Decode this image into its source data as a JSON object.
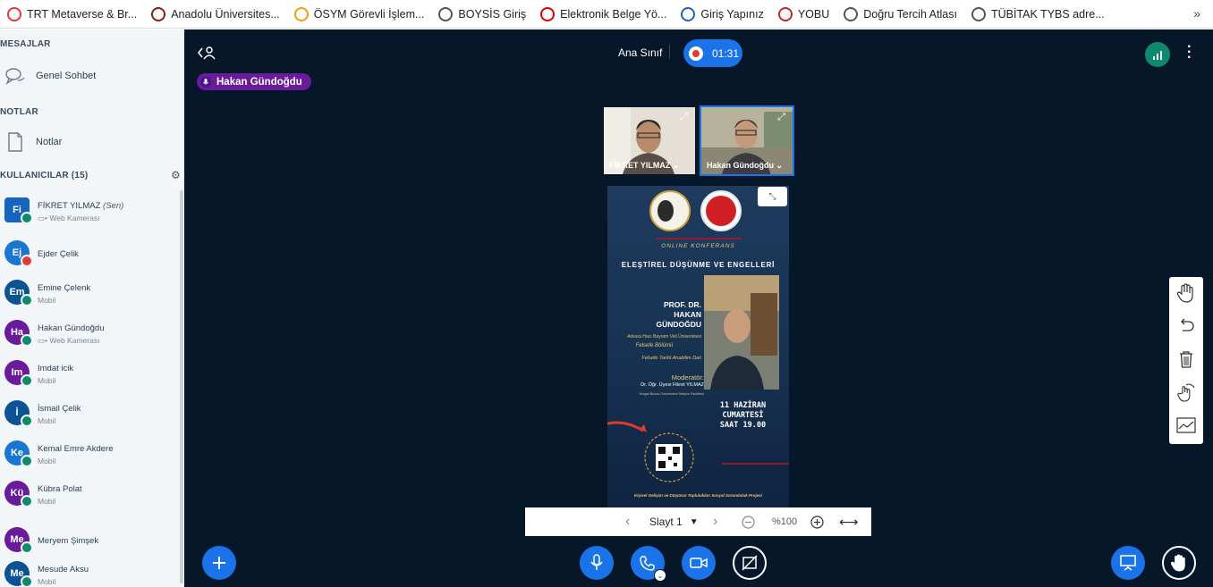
{
  "bookmarks": [
    {
      "label": "TRT Metaverse & Br...",
      "icon": "trt-icon",
      "color": "#e53935"
    },
    {
      "label": "Anadolu Üniversites...",
      "icon": "anadolu-icon",
      "color": "#8b1a1a"
    },
    {
      "label": "ÖSYM Görevli İşlem...",
      "icon": "osym-icon",
      "color": "#f39c12"
    },
    {
      "label": "BOYSİS Giriş",
      "icon": "globe-icon",
      "color": "#555555"
    },
    {
      "label": "Elektronik Belge Yö...",
      "icon": "ebys-icon",
      "color": "#e00000"
    },
    {
      "label": "Giriş Yapınız",
      "icon": "u-icon",
      "color": "#1565c0"
    },
    {
      "label": "YOBU",
      "icon": "yobu-icon",
      "color": "#c62828"
    },
    {
      "label": "Doğru Tercih Atlası",
      "icon": "globe-icon",
      "color": "#555555"
    },
    {
      "label": "TÜBİTAK TYBS adre...",
      "icon": "globe-icon",
      "color": "#555555"
    }
  ],
  "bookmarks_more": "»",
  "sidebar": {
    "messages_title": "MESAJLAR",
    "public_chat": "Genel Sohbet",
    "notes_title": "NOTLAR",
    "notes": "Notlar",
    "users_title": "KULLANICILAR (15)",
    "users": [
      {
        "initials": "Fi",
        "name": "FİKRET YILMAZ",
        "suffix": "(Sen)",
        "sub": "▭• Web Kamerası",
        "color": "#1565c0",
        "badge": "#0d8a6e",
        "square": true
      },
      {
        "initials": "Ej",
        "name": "Ejder Çelik",
        "suffix": "",
        "sub": "",
        "color": "#1976d2",
        "badge": "#e53935",
        "square": false
      },
      {
        "initials": "Em",
        "name": "Emine Çelenk",
        "suffix": "",
        "sub": "Mobil",
        "color": "#0b5394",
        "badge": "#0d8a6e",
        "square": false
      },
      {
        "initials": "Ha",
        "name": "Hakan Gündoğdu",
        "suffix": "",
        "sub": "▭• Web Kamerası",
        "color": "#6a1b9a",
        "badge": "#0d8a6e",
        "square": false
      },
      {
        "initials": "Im",
        "name": "Imdat icik",
        "suffix": "",
        "sub": "Mobil",
        "color": "#6a1b9a",
        "badge": "#0d8a6e",
        "square": false
      },
      {
        "initials": "İ",
        "name": "İsmail Çelik",
        "suffix": "",
        "sub": "Mobil",
        "color": "#0b5394",
        "badge": "#0d8a6e",
        "square": false
      },
      {
        "initials": "Ke",
        "name": "Kemal Emre Akdere",
        "suffix": "",
        "sub": "Mobil",
        "color": "#1976d2",
        "badge": "#0d8a6e",
        "square": false
      },
      {
        "initials": "Kü",
        "name": "Kübra Polat",
        "suffix": "",
        "sub": "Mobil",
        "color": "#6a1b9a",
        "badge": "#0d8a6e",
        "square": false
      },
      {
        "initials": "Me",
        "name": "Meryem Şimşek",
        "suffix": "",
        "sub": "",
        "color": "#6a1b9a",
        "badge": "#0d8a6e",
        "square": false
      },
      {
        "initials": "Me",
        "name": "Mesude Aksu",
        "suffix": "",
        "sub": "Mobil",
        "color": "#0b5394",
        "badge": "#0d8a6e",
        "square": false
      }
    ]
  },
  "header": {
    "room_title": "Ana Sınıf",
    "recording_time": "01:31",
    "talking_indicator": "Hakan Gündoğdu"
  },
  "webcams": [
    {
      "name": "FİKRET YILMAZ ⌄"
    },
    {
      "name": "Hakan Gündoğdu ⌄"
    }
  ],
  "slide": {
    "heading1": "ONLINE KONFERANS",
    "heading2": "ELEŞTİREL DÜŞÜNME VE ENGELLERİ",
    "speaker_title": "PROF. DR.",
    "speaker_first": "HAKAN",
    "speaker_last": "GÜNDOĞDU",
    "university": "Ankara Hacı Bayram Veli Üniversitesi",
    "dept": "Felsefe Bölümü",
    "subdept": "Felsefe Tarihi Anabilim Dalı",
    "moderator_label": "Moderatör:",
    "moderator": "Dr. Öğr. Üyesi Fikret YILMAZ",
    "moderator_univ": "Yozgat Bozok Üniversitesi İletişim Fakültesi",
    "date1": "11 HAZİRAN",
    "date2": "CUMARTESİ",
    "time": "SAAT 19.00",
    "footer": "Kişisel Gelişim ve Düşünce Toplulukları Sosyal Sorumluluk Projesi"
  },
  "slide_controls": {
    "slide_label": "Slayt 1",
    "zoom": "%100"
  }
}
